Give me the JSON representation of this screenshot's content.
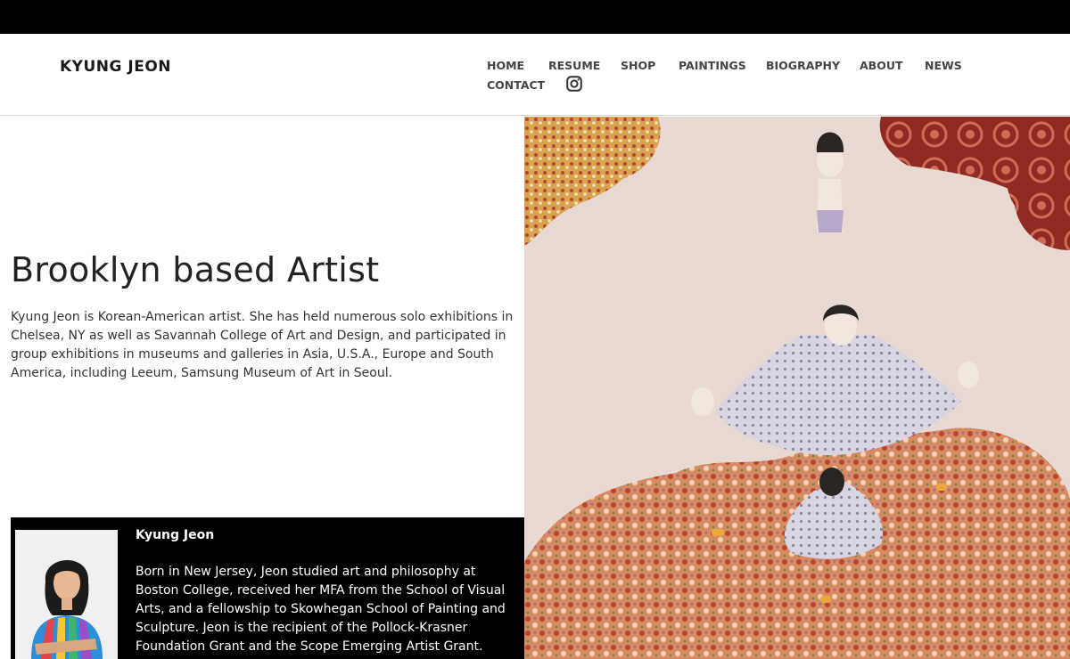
{
  "site": {
    "brand": "KYUNG JEON"
  },
  "nav": {
    "home": "HOME",
    "resume": "RESUME",
    "shop": "SHOP",
    "paintings": "PAINTINGS",
    "biography": "BIOGRAPHY",
    "about": "ABOUT",
    "news": "NEWS",
    "contact": "CONTACT",
    "instagram_icon": "instagram-icon"
  },
  "hero": {
    "headline": "Brooklyn based Artist",
    "intro": "Kyung Jeon is Korean-American artist. She has held numerous solo exhibitions in Chelsea, NY as well as Savannah College of Art and Design, and participated in group exhibitions in museums and galleries in Asia, U.S.A., Europe and South America, including Leeum, Samsung Museum of Art in Seoul."
  },
  "bio": {
    "name": "Kyung Jeon",
    "text": "Born in New Jersey, Jeon studied art and philosophy at Boston College, received her MFA from the School of Visual Arts, and a fellowship to Skowhegan School of Painting and Sculpture. Jeon is the recipient of the Pollock-Krasner Foundation Grant and the Scope Emerging Artist Grant."
  },
  "colors": {
    "topbar": "#000000",
    "bio_background": "#000000",
    "text": "#222222",
    "nav": "#444444",
    "painting_ground": "#e8d9d2"
  }
}
